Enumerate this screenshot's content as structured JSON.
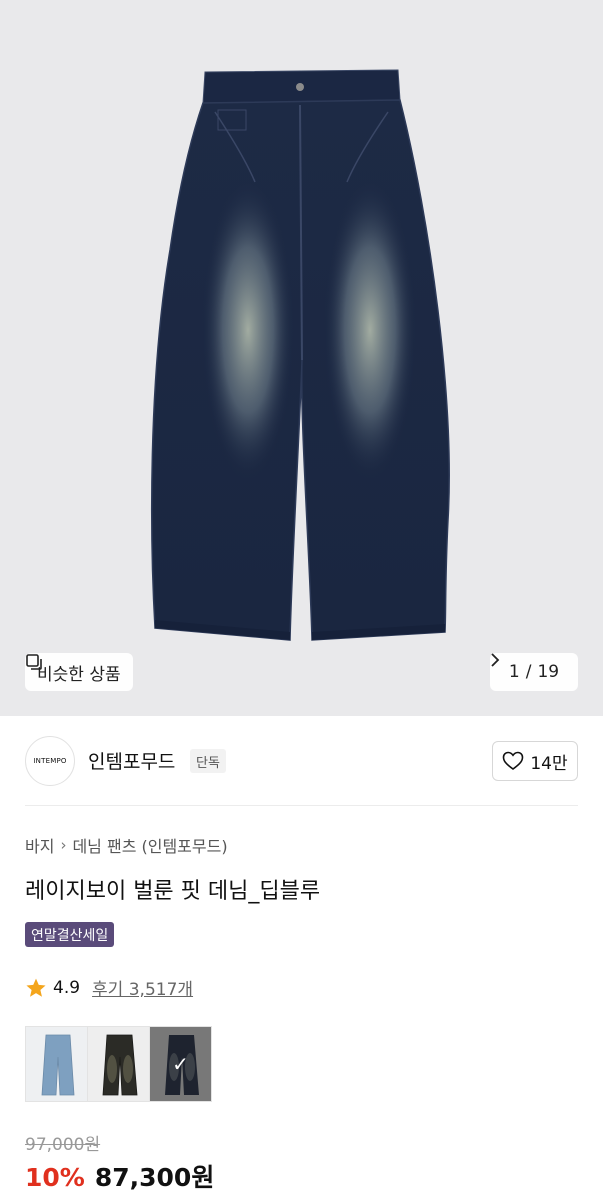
{
  "hero": {
    "similar_label": "비슷한 상품",
    "pager": {
      "current": "1",
      "separator": "/",
      "total": "19"
    }
  },
  "brand": {
    "logo_text": "INTEMPO",
    "name": "인템포무드",
    "badge": "단독",
    "likes": "14만"
  },
  "product": {
    "breadcrumb": [
      "바지",
      "데님 팬츠 (인템포무드)"
    ],
    "title": "레이지보이 벌룬 핏 데님_딥블루",
    "sale_badge": "연말결산세일",
    "rating": "4.9",
    "reviews": "후기 3,517개",
    "swatch_colors": [
      "#7ea0c0",
      "#2b2b26",
      "#1f2b45"
    ]
  },
  "price": {
    "original": "97,000원",
    "discount": "10%",
    "final": "87,300원"
  },
  "colors": {
    "accent_red": "#e0301e",
    "badge_purple": "#5a4b7a",
    "star": "#f4a51c"
  }
}
